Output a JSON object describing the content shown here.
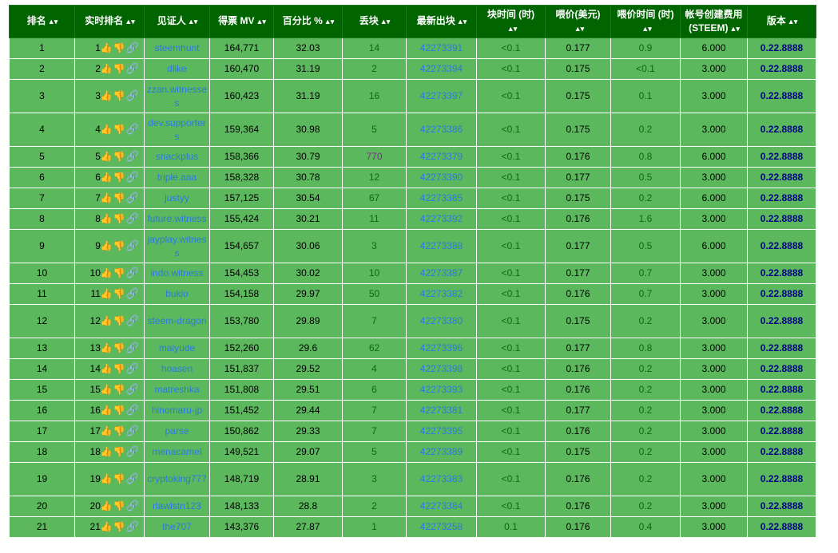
{
  "headers": {
    "rank": "排名",
    "live_rank": "实时排名",
    "witness": "见证人",
    "votes": "得票 MV",
    "percent": "百分比 %",
    "missed": "丢块",
    "last_block": "最新出块",
    "block_time_l1": "块时间 (时)",
    "price_usd_l1": "喂价(美元)",
    "price_time_l1": "喂价时间 (时)",
    "account_fee_l1": "帐号创建费用",
    "account_fee_l2": "(STEEM)",
    "version": "版本",
    "sort_arrow": "▲▾"
  },
  "rows": [
    {
      "rank": "1",
      "live": "1",
      "witness": "steemhunt",
      "votes": "164,771",
      "pct": "32.03",
      "missed": "14",
      "missed_color": "green",
      "block": "42273391",
      "bt": "<0.1",
      "price": "0.177",
      "pt": "0.9",
      "fee": "6.000",
      "ver": "0.22.8888",
      "tall": false
    },
    {
      "rank": "2",
      "live": "2",
      "witness": "dlike",
      "votes": "160,470",
      "pct": "31.19",
      "missed": "2",
      "missed_color": "green",
      "block": "42273394",
      "bt": "<0.1",
      "price": "0.175",
      "pt": "<0.1",
      "fee": "3.000",
      "ver": "0.22.8888",
      "tall": false
    },
    {
      "rank": "3",
      "live": "3",
      "witness": "zzan.witnesses",
      "votes": "160,423",
      "pct": "31.19",
      "missed": "16",
      "missed_color": "green",
      "block": "42273397",
      "bt": "<0.1",
      "price": "0.175",
      "pt": "0.1",
      "fee": "3.000",
      "ver": "0.22.8888",
      "tall": true
    },
    {
      "rank": "4",
      "live": "4",
      "witness": "dev.supporters",
      "votes": "159,364",
      "pct": "30.98",
      "missed": "5",
      "missed_color": "green",
      "block": "42273386",
      "bt": "<0.1",
      "price": "0.175",
      "pt": "0.2",
      "fee": "3.000",
      "ver": "0.22.8888",
      "tall": true
    },
    {
      "rank": "5",
      "live": "5",
      "witness": "snackplus",
      "votes": "158,366",
      "pct": "30.79",
      "missed": "770",
      "missed_color": "purple",
      "block": "42273379",
      "bt": "<0.1",
      "price": "0.176",
      "pt": "0.8",
      "fee": "6.000",
      "ver": "0.22.8888",
      "tall": false
    },
    {
      "rank": "6",
      "live": "6",
      "witness": "triple.aaa",
      "votes": "158,328",
      "pct": "30.78",
      "missed": "12",
      "missed_color": "green",
      "block": "42273390",
      "bt": "<0.1",
      "price": "0.177",
      "pt": "0.5",
      "fee": "3.000",
      "ver": "0.22.8888",
      "tall": false
    },
    {
      "rank": "7",
      "live": "7",
      "witness": "justyy",
      "votes": "157,125",
      "pct": "30.54",
      "missed": "67",
      "missed_color": "green",
      "block": "42273385",
      "bt": "<0.1",
      "price": "0.175",
      "pt": "0.2",
      "fee": "6.000",
      "ver": "0.22.8888",
      "tall": false
    },
    {
      "rank": "8",
      "live": "8",
      "witness": "future.witness",
      "votes": "155,424",
      "pct": "30.21",
      "missed": "11",
      "missed_color": "green",
      "block": "42273392",
      "bt": "<0.1",
      "price": "0.176",
      "pt": "1.6",
      "fee": "3.000",
      "ver": "0.22.8888",
      "tall": false
    },
    {
      "rank": "9",
      "live": "9",
      "witness": "jayplay.witness",
      "votes": "154,657",
      "pct": "30.06",
      "missed": "3",
      "missed_color": "green",
      "block": "42273388",
      "bt": "<0.1",
      "price": "0.177",
      "pt": "0.5",
      "fee": "6.000",
      "ver": "0.22.8888",
      "tall": true
    },
    {
      "rank": "10",
      "live": "10",
      "witness": "indo.witness",
      "votes": "154,453",
      "pct": "30.02",
      "missed": "10",
      "missed_color": "green",
      "block": "42273387",
      "bt": "<0.1",
      "price": "0.177",
      "pt": "0.7",
      "fee": "3.000",
      "ver": "0.22.8888",
      "tall": false
    },
    {
      "rank": "11",
      "live": "11",
      "witness": "bukio",
      "votes": "154,158",
      "pct": "29.97",
      "missed": "50",
      "missed_color": "green",
      "block": "42273382",
      "bt": "<0.1",
      "price": "0.176",
      "pt": "0.7",
      "fee": "3.000",
      "ver": "0.22.8888",
      "tall": false
    },
    {
      "rank": "12",
      "live": "12",
      "witness": "steem-dragon",
      "votes": "153,780",
      "pct": "29.89",
      "missed": "7",
      "missed_color": "green",
      "block": "42273380",
      "bt": "<0.1",
      "price": "0.175",
      "pt": "0.2",
      "fee": "3.000",
      "ver": "0.22.8888",
      "tall": true
    },
    {
      "rank": "13",
      "live": "13",
      "witness": "maiyude",
      "votes": "152,260",
      "pct": "29.6",
      "missed": "62",
      "missed_color": "green",
      "block": "42273396",
      "bt": "<0.1",
      "price": "0.177",
      "pt": "0.8",
      "fee": "3.000",
      "ver": "0.22.8888",
      "tall": false
    },
    {
      "rank": "14",
      "live": "14",
      "witness": "hoasen",
      "votes": "151,837",
      "pct": "29.52",
      "missed": "4",
      "missed_color": "green",
      "block": "42273398",
      "bt": "<0.1",
      "price": "0.176",
      "pt": "0.2",
      "fee": "3.000",
      "ver": "0.22.8888",
      "tall": false
    },
    {
      "rank": "15",
      "live": "15",
      "witness": "matreshka",
      "votes": "151,808",
      "pct": "29.51",
      "missed": "6",
      "missed_color": "green",
      "block": "42273393",
      "bt": "<0.1",
      "price": "0.176",
      "pt": "0.2",
      "fee": "3.000",
      "ver": "0.22.8888",
      "tall": false
    },
    {
      "rank": "16",
      "live": "16",
      "witness": "hinomaru-jp",
      "votes": "151,452",
      "pct": "29.44",
      "missed": "7",
      "missed_color": "green",
      "block": "42273381",
      "bt": "<0.1",
      "price": "0.177",
      "pt": "0.2",
      "fee": "3.000",
      "ver": "0.22.8888",
      "tall": false
    },
    {
      "rank": "17",
      "live": "17",
      "witness": "parse",
      "votes": "150,862",
      "pct": "29.33",
      "missed": "7",
      "missed_color": "green",
      "block": "42273395",
      "bt": "<0.1",
      "price": "0.176",
      "pt": "0.2",
      "fee": "3.000",
      "ver": "0.22.8888",
      "tall": false
    },
    {
      "rank": "18",
      "live": "18",
      "witness": "menacamel",
      "votes": "149,521",
      "pct": "29.07",
      "missed": "5",
      "missed_color": "green",
      "block": "42273389",
      "bt": "<0.1",
      "price": "0.175",
      "pt": "0.2",
      "fee": "3.000",
      "ver": "0.22.8888",
      "tall": false
    },
    {
      "rank": "19",
      "live": "19",
      "witness": "cryptoking777",
      "votes": "148,719",
      "pct": "28.91",
      "missed": "3",
      "missed_color": "green",
      "block": "42273383",
      "bt": "<0.1",
      "price": "0.176",
      "pt": "0.2",
      "fee": "3.000",
      "ver": "0.22.8888",
      "tall": true
    },
    {
      "rank": "20",
      "live": "20",
      "witness": "rlawlstn123",
      "votes": "148,133",
      "pct": "28.8",
      "missed": "2",
      "missed_color": "green",
      "block": "42273384",
      "bt": "<0.1",
      "price": "0.176",
      "pt": "0.2",
      "fee": "3.000",
      "ver": "0.22.8888",
      "tall": false
    },
    {
      "rank": "21",
      "live": "21",
      "witness": "the707",
      "votes": "143,376",
      "pct": "27.87",
      "missed": "1",
      "missed_color": "green",
      "block": "42273258",
      "bt": "0.1",
      "price": "0.176",
      "pt": "0.4",
      "fee": "3.000",
      "ver": "0.22.8888",
      "tall": false
    }
  ],
  "icons": {
    "up": "thumbs-up-icon",
    "down": "thumbs-down-icon",
    "link": "chain-link-icon"
  },
  "colors": {
    "header_bg": "#006400",
    "row_bg": "#5cb85c",
    "link": "#2a7ae2",
    "version": "#00008b",
    "missed_alert": "#7b2d86"
  }
}
